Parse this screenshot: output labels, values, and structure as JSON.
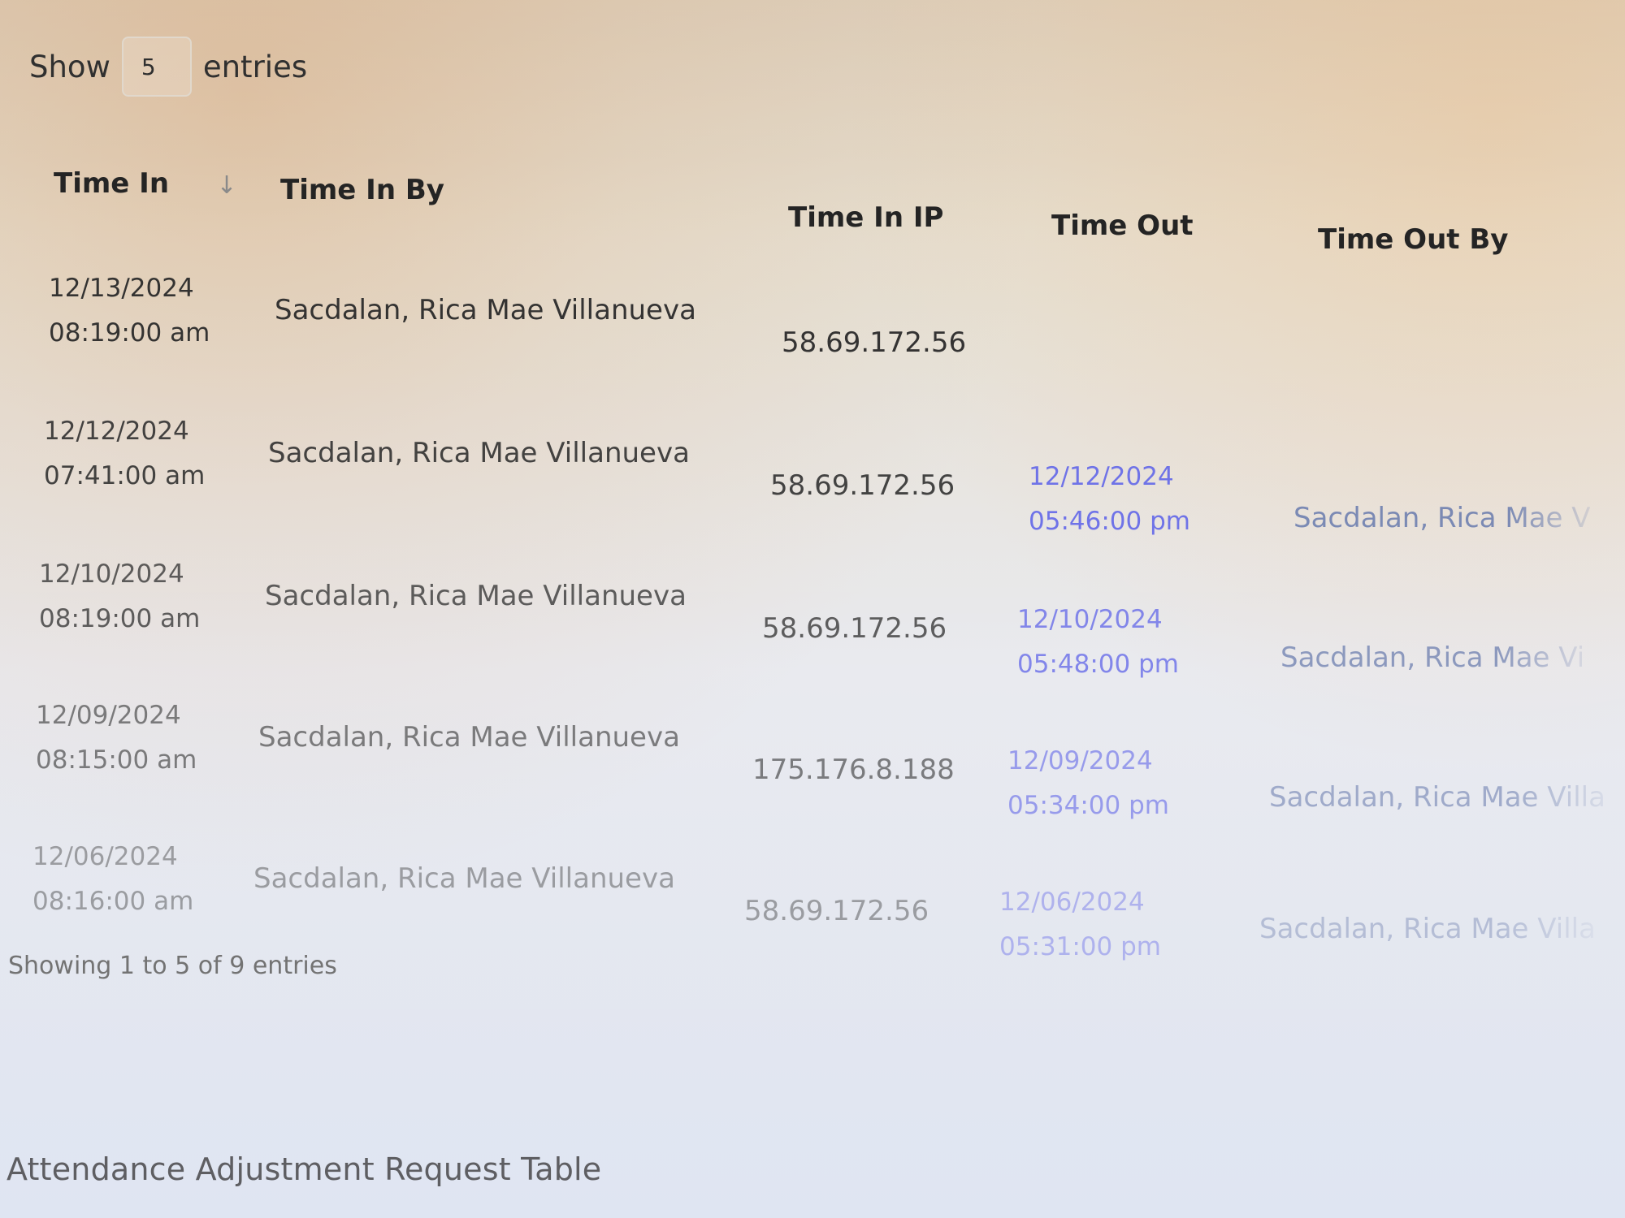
{
  "controls": {
    "show_label": "Show",
    "entries_value": "5",
    "entries_label": "entries"
  },
  "table": {
    "headers": {
      "time_in": "Time In",
      "time_in_by": "Time In By",
      "time_in_ip": "Time In IP",
      "time_out": "Time Out",
      "time_out_by": "Time Out By"
    },
    "rows": [
      {
        "time_in_date": "12/13/2024",
        "time_in_time": "08:19:00 am",
        "time_in_by": "Sacdalan, Rica Mae Villanueva",
        "time_in_ip": "58.69.172.56",
        "time_out_date": "",
        "time_out_time": "",
        "time_out_by": ""
      },
      {
        "time_in_date": "12/12/2024",
        "time_in_time": "07:41:00 am",
        "time_in_by": "Sacdalan, Rica Mae Villanueva",
        "time_in_ip": "58.69.172.56",
        "time_out_date": "12/12/2024",
        "time_out_time": "05:46:00 pm",
        "time_out_by": "Sacdalan, Rica Mae V"
      },
      {
        "time_in_date": "12/10/2024",
        "time_in_time": "08:19:00 am",
        "time_in_by": "Sacdalan, Rica Mae Villanueva",
        "time_in_ip": "58.69.172.56",
        "time_out_date": "12/10/2024",
        "time_out_time": "05:48:00 pm",
        "time_out_by": "Sacdalan, Rica Mae Vi"
      },
      {
        "time_in_date": "12/09/2024",
        "time_in_time": "08:15:00 am",
        "time_in_by": "Sacdalan, Rica Mae Villanueva",
        "time_in_ip": "175.176.8.188",
        "time_out_date": "12/09/2024",
        "time_out_time": "05:34:00 pm",
        "time_out_by": "Sacdalan, Rica Mae Villa"
      },
      {
        "time_in_date": "12/06/2024",
        "time_in_time": "08:16:00 am",
        "time_in_by": "Sacdalan, Rica Mae Villanueva",
        "time_in_ip": "58.69.172.56",
        "time_out_date": "12/06/2024",
        "time_out_time": "05:31:00 pm",
        "time_out_by": "Sacdalan, Rica Mae Villa"
      }
    ]
  },
  "footer": {
    "showing_text": "Showing 1 to 5 of 9 entries"
  },
  "next_section": {
    "title": "Attendance Adjustment Request Table"
  }
}
